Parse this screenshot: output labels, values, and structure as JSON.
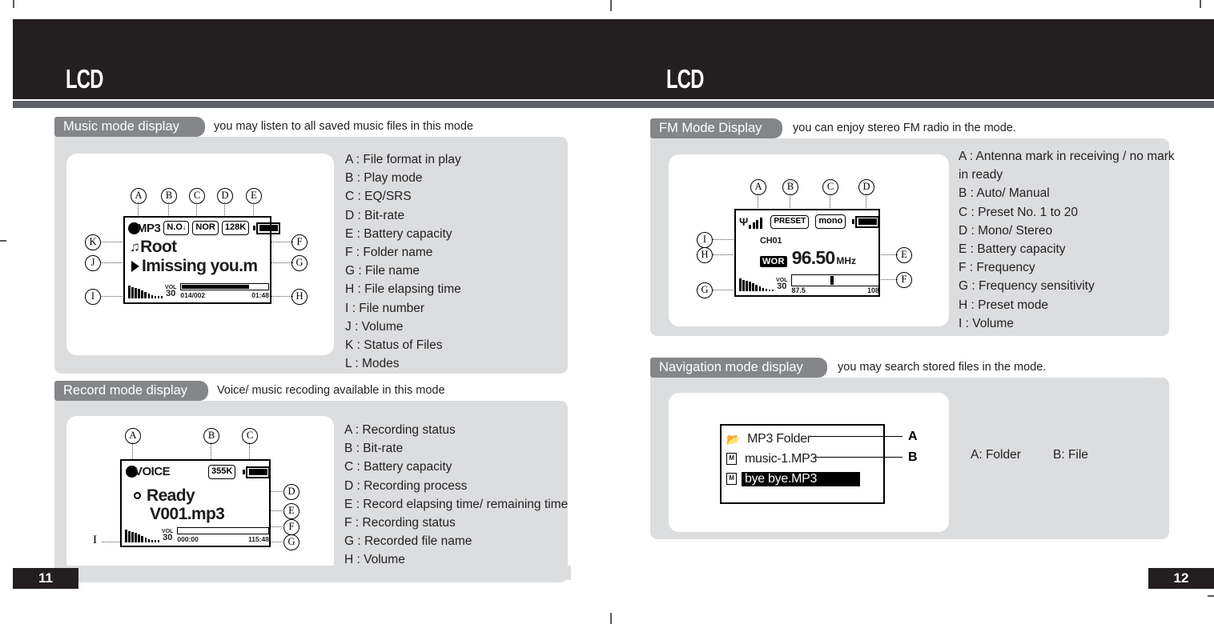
{
  "header": {
    "left_title": "LCD",
    "right_title": "LCD"
  },
  "footer": {
    "left_page": "11",
    "right_page": "12"
  },
  "sections": {
    "music": {
      "tab_label": "Music mode display",
      "caption": "you may listen to all saved music files in this mode",
      "screen": {
        "format_icon": "filled-circle",
        "format_text": "MP3",
        "play_mode": "N.O",
        "eq": "NOR",
        "bitrate": "128K",
        "battery": "full",
        "folder_name": "Root",
        "file_name": "Imissing you.m",
        "vol_caption": "VOL",
        "vol_value": "30",
        "file_number": "014/002",
        "elapsed": "01:48"
      },
      "callouts_top": [
        "A",
        "B",
        "C",
        "D",
        "E"
      ],
      "callouts_left": [
        "K",
        "J",
        "I"
      ],
      "callouts_right": [
        "F",
        "G",
        "H"
      ],
      "legend": [
        "A : File format in play",
        "B : Play mode",
        "C : EQ/SRS",
        "D : Bit-rate",
        "E : Battery capacity",
        "F : Folder name",
        "G : File name",
        "H : File elapsing time",
        " I : File number",
        "J : Volume",
        "K : Status of Files",
        "L : Modes"
      ]
    },
    "record": {
      "tab_label": "Record mode display",
      "caption": "Voice/ music recoding available in this mode",
      "screen": {
        "mode_icon": "filled-circle",
        "mode_text": "VOICE",
        "bitrate": "355K",
        "battery": "full",
        "status_text": "Ready",
        "file_name": "V001.mp3",
        "vol_caption": "VOL",
        "vol_value": "30",
        "elapsed": "000:00",
        "remaining": "115:48"
      },
      "callouts_top": [
        "A",
        "B",
        "C"
      ],
      "callouts_left": [
        "I"
      ],
      "callouts_right": [
        "D",
        "E",
        "F",
        "G"
      ],
      "legend": [
        "A : Recording status",
        "B : Bit-rate",
        "C : Battery capacity",
        "D : Recording process",
        "E : Record elapsing time/ remaining time",
        "F : Recording status",
        "G : Recorded file name",
        "H : Volume"
      ]
    },
    "fm": {
      "tab_label": "FM Mode Display",
      "caption": "you can enjoy stereo FM radio in the mode.",
      "screen": {
        "antenna_icon": "antenna-signal",
        "preset": "PRESET",
        "stereo_mode": "mono",
        "battery": "full",
        "channel": "CH01",
        "preset_mode": "WOR",
        "frequency": "96.50",
        "frequency_unit": "MHz",
        "vol_caption": "VOL",
        "vol_value": "30",
        "scale_min": "87.5",
        "scale_max": "108"
      },
      "callouts_top": [
        "A",
        "B",
        "C",
        "D"
      ],
      "callouts_left": [
        "I",
        "H",
        "G"
      ],
      "callouts_right": [
        "E",
        "F"
      ],
      "legend": [
        "A : Antenna mark in receiving / no mark",
        "     in ready",
        "B : Auto/ Manual",
        "C : Preset No. 1 to 20",
        "D : Mono/ Stereo",
        "E : Battery capacity",
        "F : Frequency",
        "G : Frequency sensitivity",
        "H : Preset mode",
        " I : Volume"
      ]
    },
    "navigation": {
      "tab_label": "Navigation mode display",
      "caption": "you may search stored files in the mode.",
      "screen": {
        "rows": [
          {
            "icon": "folder-icon",
            "label": "MP3 Folder",
            "selected": false
          },
          {
            "icon": "music-file-icon",
            "label": "music-1.MP3",
            "selected": false
          },
          {
            "icon": "music-file-icon",
            "label": "bye bye.MP3",
            "selected": true
          }
        ]
      },
      "callouts_right": [
        "A",
        "B"
      ],
      "legend": [
        "A: Folder",
        "B: File"
      ]
    }
  },
  "colors": {
    "header_bg": "#231f20",
    "header_rule": "#5d6065",
    "tab_bg": "#848689",
    "panel_bg": "#dcdddf",
    "card_bg": "#ffffff",
    "text": "#231f20"
  }
}
